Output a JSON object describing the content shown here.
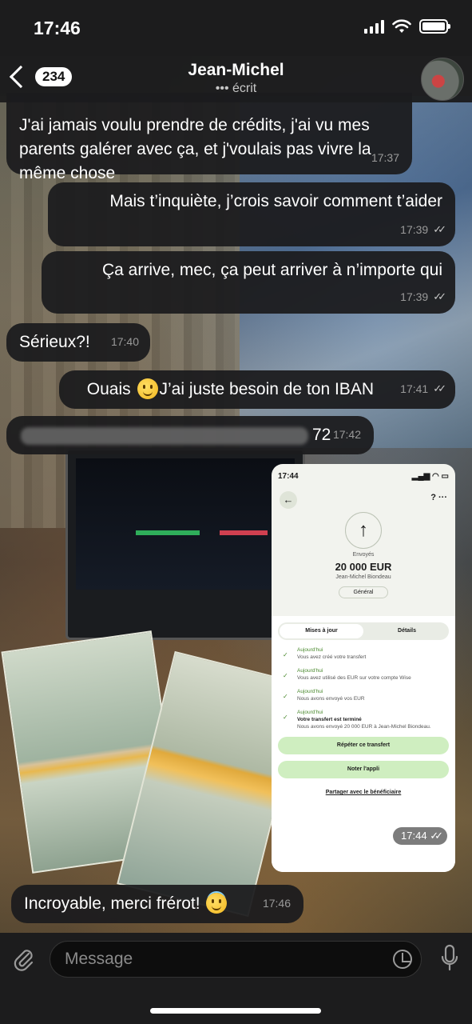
{
  "status_bar": {
    "time": "17:46"
  },
  "header": {
    "back_badge": "234",
    "contact_name": "Jean-Michel",
    "contact_status": "••• écrit"
  },
  "messages": [
    {
      "id": 1,
      "direction": "in",
      "text": "J'ai jamais voulu prendre de crédits, j'ai vu mes parents galérer avec ça, et j'voulais pas vivre la même chose",
      "time": "17:37"
    },
    {
      "id": 2,
      "direction": "out",
      "text": "Mais t’inquiète, j’crois savoir comment t’aider",
      "time": "17:39",
      "read": true
    },
    {
      "id": 3,
      "direction": "out",
      "text": "Ça arrive, mec, ça peut arriver à n’importe qui",
      "time": "17:39",
      "read": true
    },
    {
      "id": 4,
      "direction": "in",
      "text": "Sérieux?!",
      "time": "17:40"
    },
    {
      "id": 5,
      "direction": "out",
      "text_before": "Ouais",
      "text_after": "J’ai juste besoin de ton IBAN",
      "emoji": "slightly-smiling-face",
      "time": "17:41",
      "read": true
    },
    {
      "id": 6,
      "direction": "in",
      "redacted": true,
      "visible_tail": "72",
      "time": "17:42"
    },
    {
      "id": 8,
      "direction": "in",
      "text": "Incroyable, merci frérot!",
      "emoji": "smiling-face-with-halo",
      "time": "17:46"
    }
  ],
  "screenshot_message": {
    "time": "17:44",
    "read": true,
    "status_time": "17:44",
    "label_sent": "Envoyés",
    "amount": "20 000 EUR",
    "recipient": "Jean-Michel Biondeau",
    "chip": "Général",
    "tabs": [
      "Mises à jour",
      "Détails"
    ],
    "steps": [
      {
        "when": "Aujourd'hui",
        "text": "Vous avez créé votre transfert"
      },
      {
        "when": "Aujourd'hui",
        "text": "Vous avez utilisé des EUR sur votre compte Wise"
      },
      {
        "when": "Aujourd'hui",
        "text": "Nous avons envoyé vos EUR"
      },
      {
        "when": "Aujourd'hui",
        "title": "Votre transfert est terminé",
        "text": "Nous avons envoyé 20 000 EUR à Jean-Michel Biondeau."
      }
    ],
    "button_repeat": "Répéter ce transfert",
    "button_rate": "Noter l'appli",
    "link_share": "Partager avec le bénéficiaire"
  },
  "input": {
    "placeholder": "Message"
  },
  "icons": {
    "back": "chevron-left-icon",
    "attach": "paperclip-icon",
    "sticker": "sticker-icon",
    "mic": "microphone-icon"
  }
}
